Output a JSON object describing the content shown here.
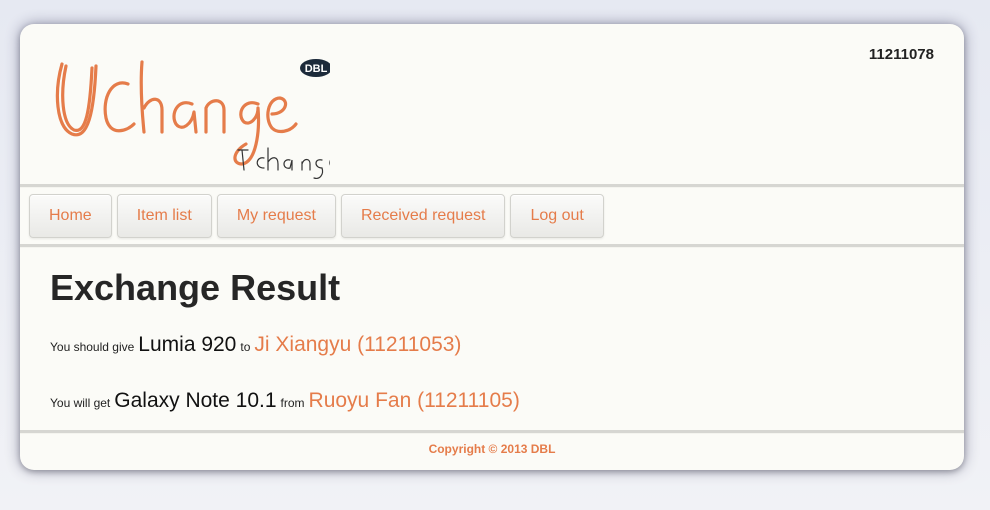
{
  "header": {
    "logo_text": "UChange",
    "logo_badge": "DBL",
    "logo_tagline": "I change",
    "user_id": "11211078"
  },
  "nav": {
    "items": [
      {
        "label": "Home"
      },
      {
        "label": "Item list"
      },
      {
        "label": "My request"
      },
      {
        "label": "Received request"
      },
      {
        "label": "Log out"
      }
    ]
  },
  "main": {
    "title": "Exchange Result",
    "give": {
      "prefix": "You should give",
      "item": "Lumia 920",
      "connector": "to",
      "person": "Ji Xiangyu (11211053)"
    },
    "get": {
      "prefix": "You will get",
      "item": "Galaxy Note 10.1",
      "connector": "from",
      "person": "Ruoyu Fan (11211105)"
    }
  },
  "footer": {
    "copyright": "Copyright © 2013 DBL"
  },
  "colors": {
    "accent": "#e57c4a",
    "card_bg": "#fbfbf7"
  }
}
